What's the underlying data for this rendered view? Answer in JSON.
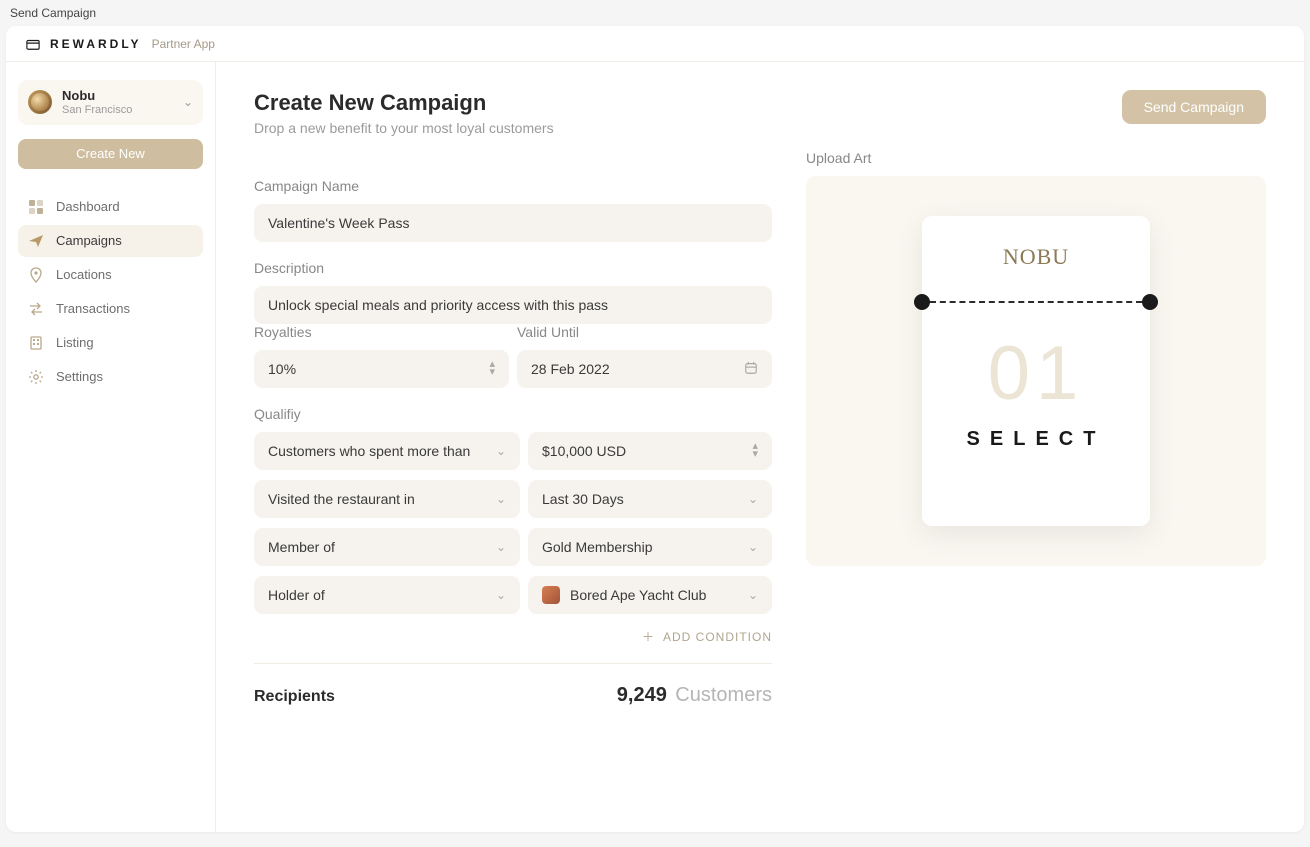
{
  "top_label": "Send Campaign",
  "brand": {
    "name": "REWARDLY",
    "sub": "Partner App"
  },
  "business": {
    "name": "Nobu",
    "location": "San Francisco"
  },
  "sidebar": {
    "create_label": "Create New",
    "items": [
      {
        "label": "Dashboard"
      },
      {
        "label": "Campaigns"
      },
      {
        "label": "Locations"
      },
      {
        "label": "Transactions"
      },
      {
        "label": "Listing"
      },
      {
        "label": "Settings"
      }
    ]
  },
  "header": {
    "title": "Create New Campaign",
    "subtitle": "Drop a new benefit to your most loyal customers",
    "send_label": "Send Campaign"
  },
  "form": {
    "campaign_name_label": "Campaign Name",
    "campaign_name_value": "Valentine's Week Pass",
    "description_label": "Description",
    "description_value": "Unlock special meals and priority access with this pass",
    "royalties_label": "Royalties",
    "royalties_value": "10%",
    "valid_until_label": "Valid Until",
    "valid_until_value": "28 Feb 2022",
    "qualify_label": "Qualifiy",
    "qualify_rows": [
      {
        "cond": "Customers who spent more than",
        "val": "$10,000 USD"
      },
      {
        "cond": "Visited the restaurant in",
        "val": "Last 30 Days"
      },
      {
        "cond": "Member of",
        "val": "Gold Membership"
      },
      {
        "cond": "Holder of",
        "val": "Bored Ape Yacht Club"
      }
    ],
    "add_condition_label": "ADD CONDITION"
  },
  "recipients": {
    "label": "Recipients",
    "count": "9,249",
    "unit": "Customers"
  },
  "art": {
    "label": "Upload Art",
    "pass_brand": "NOBU",
    "pass_number": "01",
    "pass_tier": "SELECT"
  }
}
